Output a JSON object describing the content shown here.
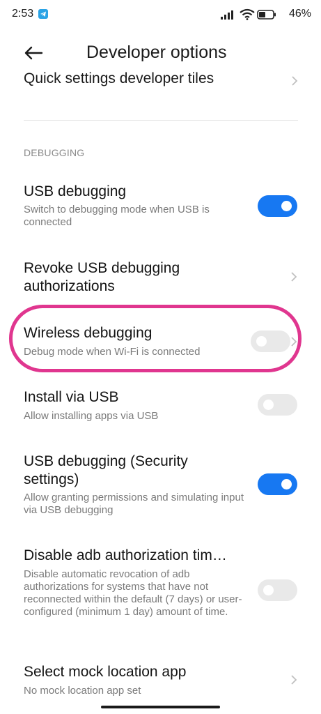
{
  "status_bar": {
    "time": "2:53",
    "battery": "46%"
  },
  "header": {
    "title": "Developer options"
  },
  "clipped_row": {
    "label": "Quick settings developer tiles"
  },
  "section": {
    "title": "DEBUGGING"
  },
  "rows": [
    {
      "title": "USB debugging",
      "subtitle": "Switch to debugging mode when USB is connected",
      "toggle": true
    },
    {
      "title": "Revoke USB debugging authorizations",
      "subtitle": ""
    },
    {
      "title": "Wireless debugging",
      "subtitle": "Debug mode when Wi-Fi is connected",
      "toggle": false
    },
    {
      "title": "Install via USB",
      "subtitle": "Allow installing apps via USB",
      "toggle": false
    },
    {
      "title": "USB debugging (Security settings)",
      "subtitle": "Allow granting permissions and simulating input via USB debugging",
      "toggle": true
    },
    {
      "title": "Disable adb authorization tim…",
      "subtitle": "Disable automatic revocation of adb authorizations for systems that have not reconnected within the default (7 days) or user-configured (minimum 1 day) amount of time.",
      "toggle": false
    },
    {
      "title": "Select mock location app",
      "subtitle": "No mock location app set"
    }
  ],
  "colors": {
    "accent": "#1778f2",
    "highlight": "#e0368f",
    "toggle_off": "#e9e9e9"
  }
}
